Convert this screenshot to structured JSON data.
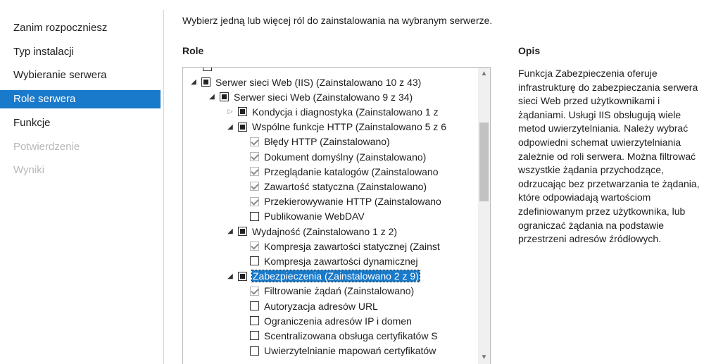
{
  "sidebar": {
    "items": [
      {
        "label": "Zanim rozpoczniesz",
        "state": "normal"
      },
      {
        "label": "Typ instalacji",
        "state": "normal"
      },
      {
        "label": "Wybieranie serwera",
        "state": "normal"
      },
      {
        "label": "Role serwera",
        "state": "active"
      },
      {
        "label": "Funkcje",
        "state": "normal"
      },
      {
        "label": "Potwierdzenie",
        "state": "disabled"
      },
      {
        "label": "Wyniki",
        "state": "disabled"
      }
    ]
  },
  "main": {
    "instruction": "Wybierz jedną lub więcej ról do zainstalowania na wybranym serwerze.",
    "roles_header": "Role",
    "description_header": "Opis",
    "description": "Funkcja Zabezpieczenia oferuje infrastrukturę do zabezpieczania serwera sieci Web przed użytkownikami i żądaniami. Usługi IIS obsługują wiele metod uwierzytelniania. Należy wybrać odpowiedni schemat uwierzytelniania zależnie od roli serwera. Można filtrować wszystkie żądania przychodzące, odrzucając bez przetwarzania te żądania, które odpowiadają wartościom zdefiniowanym przez użytkownika, lub ograniczać żądania na podstawie przestrzeni adresów źródłowych."
  },
  "tree": {
    "rows": [
      {
        "label": "Serwer sieci Web (IIS) (Zainstalowano 10 z 43)",
        "level": 0,
        "expander": "expanded",
        "check": "partial"
      },
      {
        "label": "Serwer sieci Web (Zainstalowano 9 z 34)",
        "level": 1,
        "expander": "expanded",
        "check": "partial"
      },
      {
        "label": "Kondycja i diagnostyka (Zainstalowano 1 z",
        "level": 2,
        "expander": "collapsed",
        "check": "partial"
      },
      {
        "label": "Wspólne funkcje HTTP (Zainstalowano 5 z 6",
        "level": 2,
        "expander": "expanded",
        "check": "partial"
      },
      {
        "label": "Błędy HTTP (Zainstalowano)",
        "level": 3,
        "expander": "none",
        "check": "checked"
      },
      {
        "label": "Dokument domyślny (Zainstalowano)",
        "level": 3,
        "expander": "none",
        "check": "checked"
      },
      {
        "label": "Przeglądanie katalogów (Zainstalowano",
        "level": 3,
        "expander": "none",
        "check": "checked"
      },
      {
        "label": "Zawartość statyczna (Zainstalowano)",
        "level": 3,
        "expander": "none",
        "check": "checked"
      },
      {
        "label": "Przekierowywanie HTTP (Zainstalowano",
        "level": 3,
        "expander": "none",
        "check": "checked"
      },
      {
        "label": "Publikowanie WebDAV",
        "level": 3,
        "expander": "none",
        "check": "unchecked"
      },
      {
        "label": "Wydajność (Zainstalowano 1 z 2)",
        "level": 2,
        "expander": "expanded",
        "check": "partial"
      },
      {
        "label": "Kompresja zawartości statycznej (Zainst",
        "level": 3,
        "expander": "none",
        "check": "checked"
      },
      {
        "label": "Kompresja zawartości dynamicznej",
        "level": 3,
        "expander": "none",
        "check": "unchecked"
      },
      {
        "label": "Zabezpieczenia (Zainstalowano 2 z 9)",
        "level": 2,
        "expander": "expanded",
        "check": "partial",
        "selected": true
      },
      {
        "label": "Filtrowanie żądań (Zainstalowano)",
        "level": 3,
        "expander": "none",
        "check": "checked"
      },
      {
        "label": "Autoryzacja adresów URL",
        "level": 3,
        "expander": "none",
        "check": "unchecked"
      },
      {
        "label": "Ograniczenia adresów IP i domen",
        "level": 3,
        "expander": "none",
        "check": "unchecked"
      },
      {
        "label": "Scentralizowana obsługa certyfikatów S",
        "level": 3,
        "expander": "none",
        "check": "unchecked"
      },
      {
        "label": "Uwierzytelnianie mapowań certyfikatów",
        "level": 3,
        "expander": "none",
        "check": "unchecked"
      }
    ]
  },
  "colors": {
    "accent": "#1979ca",
    "disabled": "#b8b8b8"
  }
}
